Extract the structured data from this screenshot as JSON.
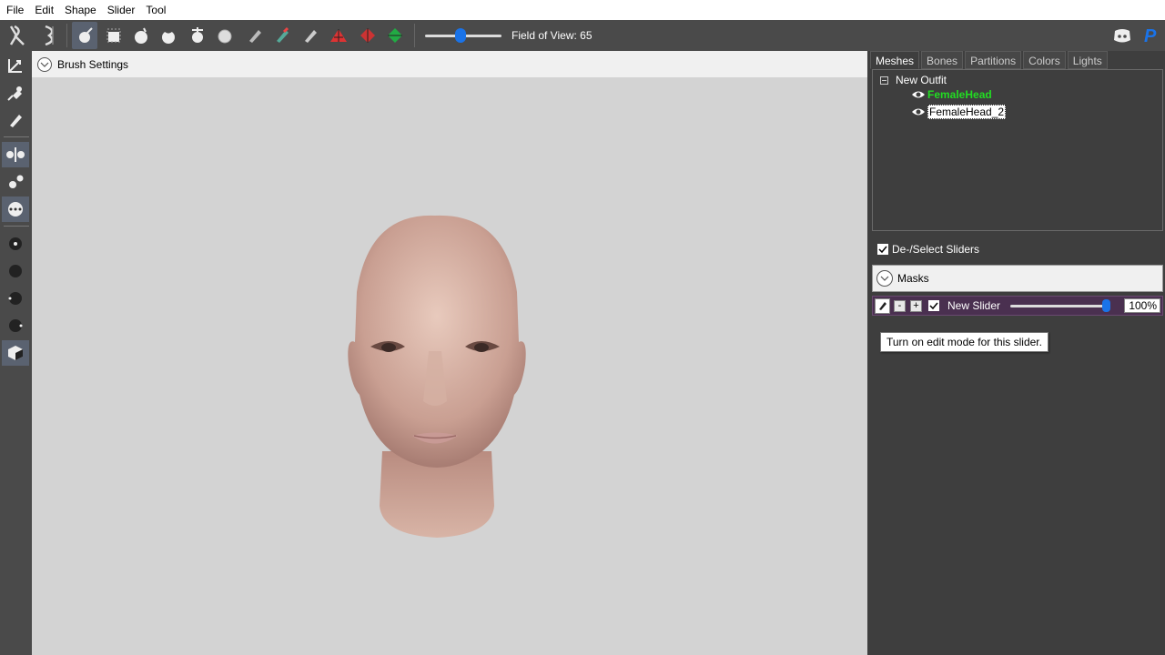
{
  "menu": [
    "File",
    "Edit",
    "Shape",
    "Slider",
    "Tool"
  ],
  "toolbar": {
    "fov_label": "Field of View: 65",
    "fov_value": 65
  },
  "brush_settings_label": "Brush Settings",
  "tabs": [
    "Meshes",
    "Bones",
    "Partitions",
    "Colors",
    "Lights"
  ],
  "tree": {
    "root": "New Outfit",
    "items": [
      {
        "label": "FemaleHead",
        "color": "#22dd22"
      },
      {
        "label": "FemaleHead_2",
        "color": "#000000"
      }
    ]
  },
  "deselect_sliders_label": "De-/Select Sliders",
  "masks_label": "Masks",
  "slider": {
    "name": "New Slider",
    "value": "100%",
    "minus": "-",
    "plus": "+"
  },
  "tooltip": "Turn on edit mode for this slider.",
  "colors": {
    "accent": "#1a73e8",
    "panel": "#3e3e3e",
    "toolbar": "#4a4a4a",
    "viewport": "#d3d3d3"
  }
}
